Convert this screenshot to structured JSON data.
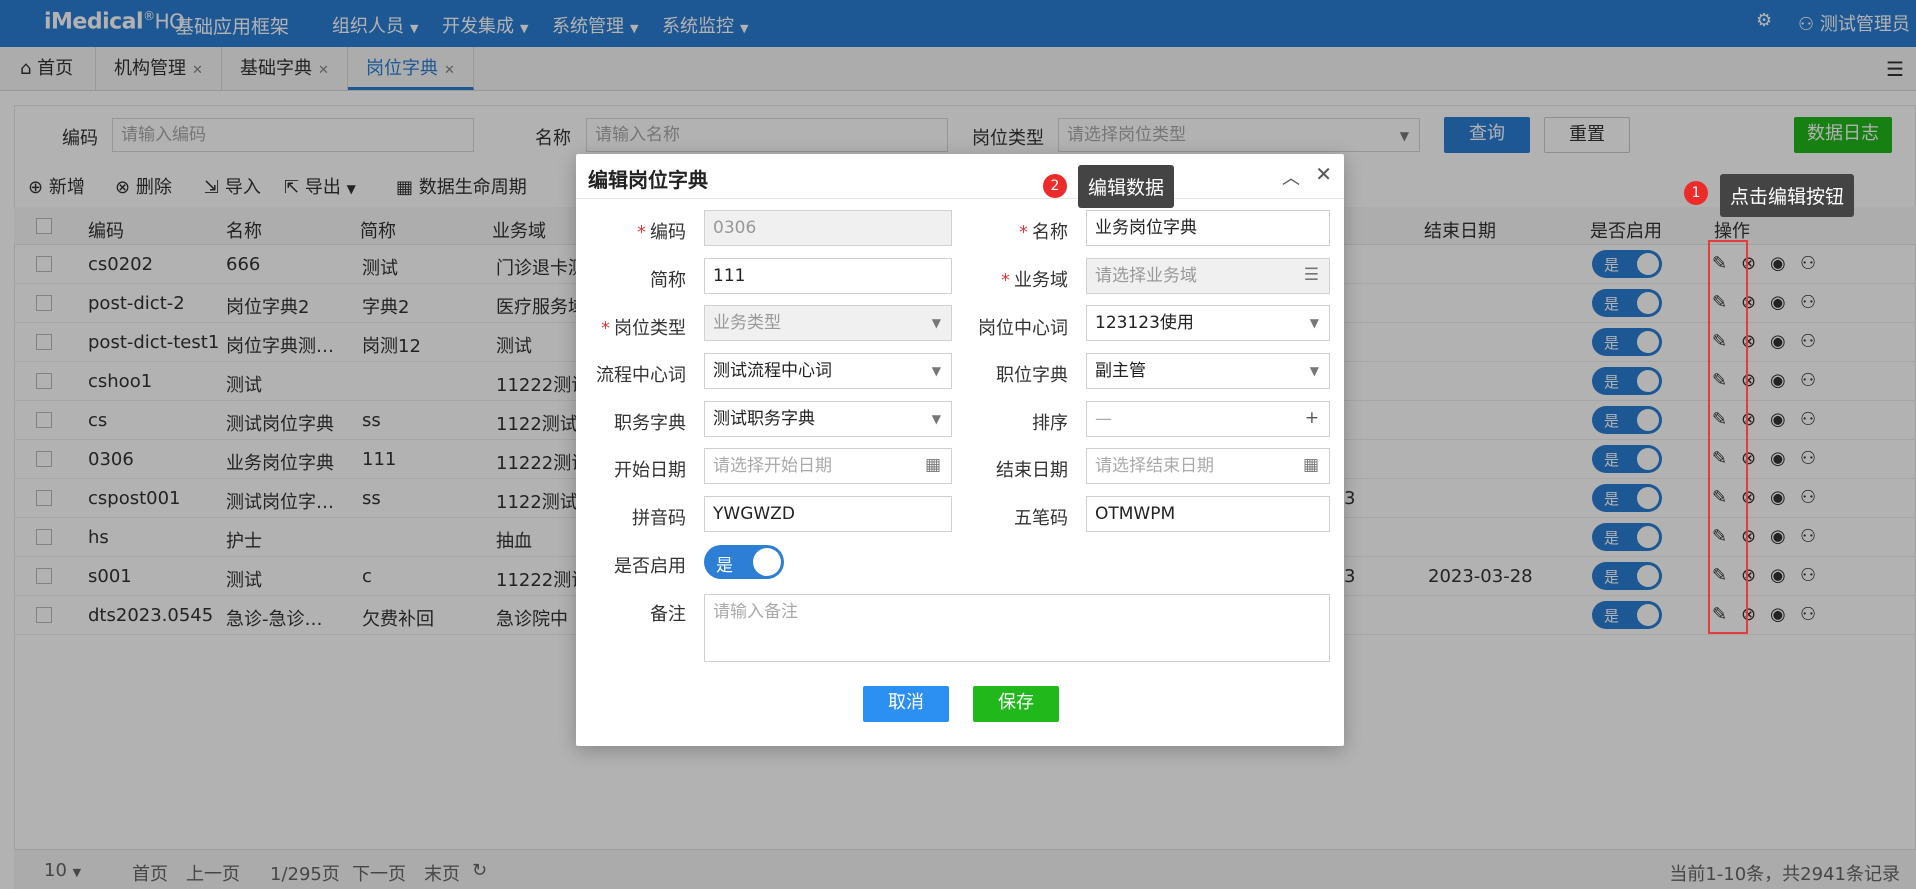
{
  "topbar": {
    "logo": "iMedical",
    "logo_reg": "®",
    "logo_suffix": "HO",
    "app_title": "基础应用框架",
    "menus": [
      "组织人员",
      "开发集成",
      "系统管理",
      "系统监控"
    ],
    "user": "测试管理员",
    "colors": {
      "bar": "#2c7fd5"
    }
  },
  "tabs": [
    {
      "label": "首页",
      "icon": "home-icon"
    },
    {
      "label": "机构管理",
      "closable": true
    },
    {
      "label": "基础字典",
      "closable": true
    },
    {
      "label": "岗位字典",
      "closable": true,
      "active": true
    }
  ],
  "search": {
    "code_label": "编码",
    "code_placeholder": "请输入编码",
    "name_label": "名称",
    "name_placeholder": "请输入名称",
    "type_label": "岗位类型",
    "type_placeholder": "请选择岗位类型",
    "query": "查询",
    "reset": "重置",
    "log": "数据日志"
  },
  "toolbar": {
    "add": "新增",
    "delete": "删除",
    "import": "导入",
    "export": "导出",
    "lifecycle": "数据生命周期"
  },
  "table": {
    "headers": {
      "code": "编码",
      "name": "名称",
      "short": "简称",
      "domain": "业务域",
      "end": "结束日期",
      "enabled": "是否启用",
      "ops": "操作"
    },
    "rows": [
      {
        "code": "cs0202",
        "name": "666",
        "short": "测试",
        "domain": "门诊退卡测",
        "extra": "",
        "end": "",
        "enabled": "是"
      },
      {
        "code": "post-dict-2",
        "name": "岗位字典2",
        "short": "字典2",
        "domain": "医疗服务域",
        "extra": "",
        "end": "",
        "enabled": "是"
      },
      {
        "code": "post-dict-test1",
        "name": "岗位字典测…",
        "short": "岗测12",
        "domain": "测试",
        "extra": "",
        "end": "",
        "enabled": "是"
      },
      {
        "code": "cshoo1",
        "name": "测试",
        "short": "",
        "domain": "11222测试",
        "extra": "",
        "end": "",
        "enabled": "是"
      },
      {
        "code": "cs",
        "name": "测试岗位字典",
        "short": "ss",
        "domain": "1122测试",
        "extra": "",
        "end": "",
        "enabled": "是"
      },
      {
        "code": "0306",
        "name": "业务岗位字典",
        "short": "111",
        "domain": "11222测试",
        "extra": "",
        "end": "",
        "enabled": "是"
      },
      {
        "code": "cspost001",
        "name": "测试岗位字…",
        "short": "ss",
        "domain": "1122测试",
        "extra": "3",
        "end": "",
        "enabled": "是"
      },
      {
        "code": "hs",
        "name": "护士",
        "short": "",
        "domain": "抽血",
        "extra": "",
        "end": "",
        "enabled": "是"
      },
      {
        "code": "s001",
        "name": "测试",
        "short": "c",
        "domain": "11222测试",
        "extra": "3",
        "end": "2023-03-28",
        "enabled": "是"
      },
      {
        "code": "dts2023.0545",
        "name": "急诊-急诊…",
        "short": "欠费补回",
        "domain": "急诊院中",
        "extra": "",
        "end": "",
        "enabled": "是"
      }
    ]
  },
  "footer": {
    "page_size": "10",
    "first": "首页",
    "prev": "上一页",
    "page": "1/295页",
    "next": "下一页",
    "last": "末页",
    "summary": "当前1-10条，共2941条记录"
  },
  "dialog": {
    "title": "编辑岗位字典",
    "code_label": "编码",
    "code_value": "0306",
    "name_label": "名称",
    "name_value": "业务岗位字典",
    "short_label": "简称",
    "short_value": "111",
    "domain_label": "业务域",
    "domain_placeholder": "请选择业务域",
    "type_label": "岗位类型",
    "type_value": "业务类型",
    "center_label": "岗位中心词",
    "center_value": "123123使用",
    "flow_label": "流程中心词",
    "flow_value": "测试流程中心词",
    "position_label": "职位字典",
    "position_value": "副主管",
    "duty_label": "职务字典",
    "duty_value": "测试职务字典",
    "sort_label": "排序",
    "sort_minus": "—",
    "sort_plus": "+",
    "start_label": "开始日期",
    "start_placeholder": "请选择开始日期",
    "end_label": "结束日期",
    "end_placeholder": "请选择结束日期",
    "pinyin_label": "拼音码",
    "pinyin_value": "YWGWZD",
    "wubi_label": "五笔码",
    "wubi_value": "OTMWPM",
    "enabled_label": "是否启用",
    "enabled_value": "是",
    "remark_label": "备注",
    "remark_placeholder": "请输入备注",
    "cancel": "取消",
    "save": "保存"
  },
  "annotations": {
    "step1_num": "1",
    "step1_text": "点击编辑按钮",
    "step2_num": "2",
    "step2_text": "编辑数据"
  }
}
